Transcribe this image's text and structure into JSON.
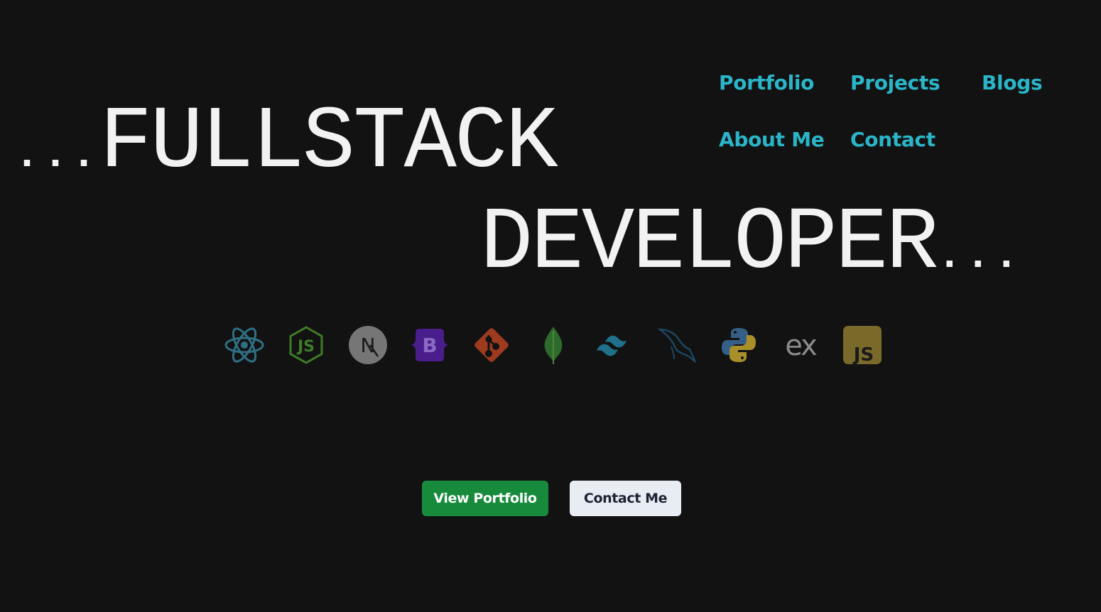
{
  "nav": {
    "items": [
      {
        "label": "Portfolio"
      },
      {
        "label": "Projects"
      },
      {
        "label": "Blogs"
      },
      {
        "label": "About Me"
      },
      {
        "label": "Contact"
      }
    ],
    "color": "#2bb5c9"
  },
  "hero": {
    "line1_prefix": "...",
    "line1_word": "FULLSTACK",
    "line2_word": "DEVELOPER",
    "line2_suffix": "..."
  },
  "tech_icons": [
    {
      "icon": "react-icon"
    },
    {
      "icon": "nodejs-icon",
      "text": "JS"
    },
    {
      "icon": "nextjs-icon",
      "text": "N"
    },
    {
      "icon": "bootstrap-icon",
      "text": "B"
    },
    {
      "icon": "git-icon"
    },
    {
      "icon": "mongodb-icon"
    },
    {
      "icon": "tailwind-icon"
    },
    {
      "icon": "mysql-icon"
    },
    {
      "icon": "python-icon"
    },
    {
      "icon": "express-icon",
      "text": "ex"
    },
    {
      "icon": "javascript-icon",
      "text": "JS"
    }
  ],
  "buttons": {
    "view_portfolio": "View Portfolio",
    "contact_me": "Contact Me"
  },
  "colors": {
    "background": "#121212",
    "primary_button": "#188a3c",
    "secondary_button": "#e8ecf3"
  }
}
